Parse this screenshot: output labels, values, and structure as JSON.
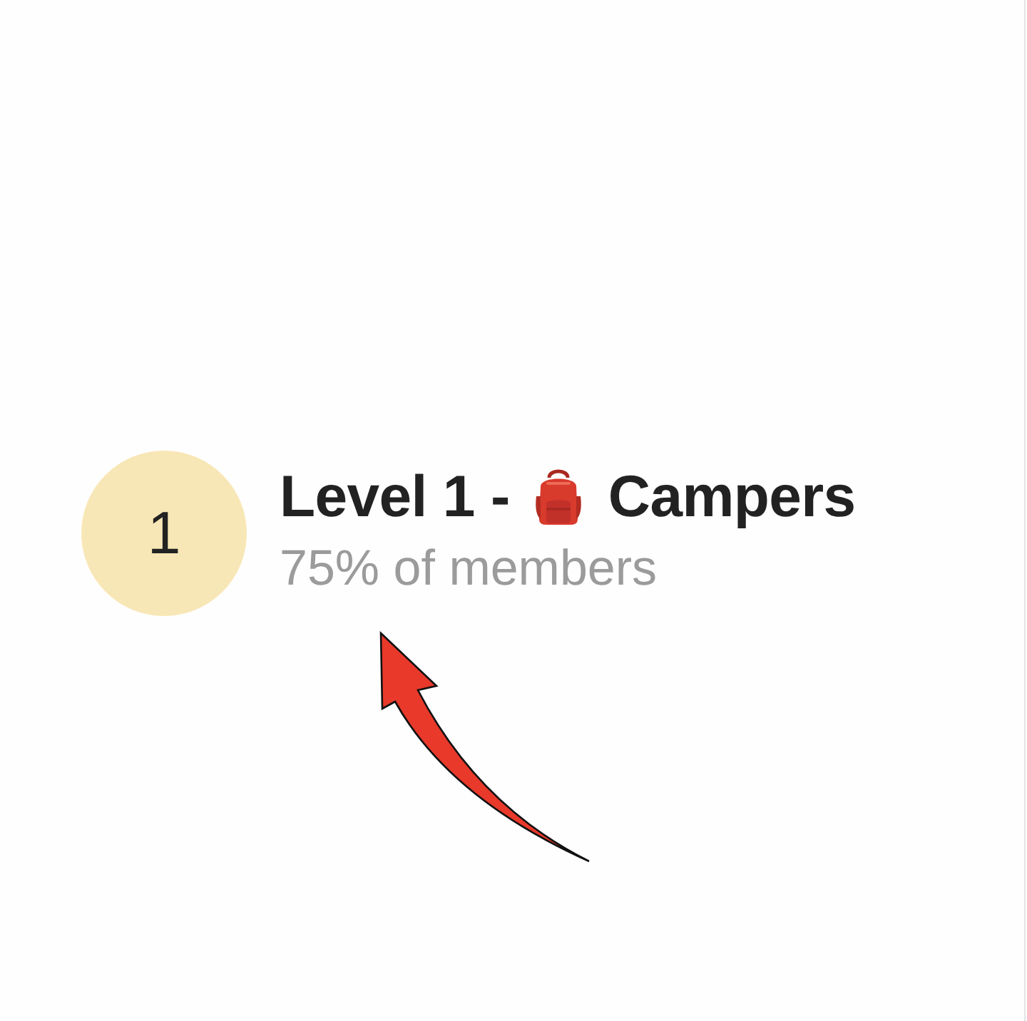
{
  "level": {
    "number": "1",
    "title_start": "Level 1 -",
    "title_end": "Campers",
    "subtitle": "75% of members"
  }
}
